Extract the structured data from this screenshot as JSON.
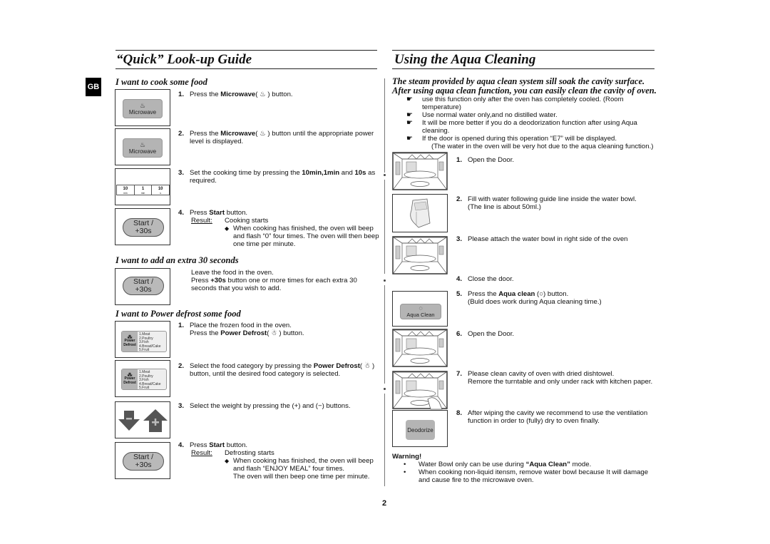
{
  "left": {
    "title": "“Quick” Look-up Guide",
    "lang_badge": "GB",
    "sections": {
      "cook": {
        "heading": "I want to cook some food",
        "steps": [
          {
            "num": "1.",
            "pre": "Press the ",
            "bold": "Microwave",
            "post": "( ♨ ) button."
          },
          {
            "num": "2.",
            "pre": "Press the ",
            "bold": "Microwave",
            "post": "( ♨ ) button until the appropriate power level is displayed."
          },
          {
            "num": "3.",
            "pre": "Set the cooking time by pressing the ",
            "bold": "10min,1min",
            "mid": " and ",
            "bold2": "10s",
            "post": " as required."
          },
          {
            "num": "4.",
            "pre": "Press ",
            "bold": "Start",
            "post": " button.",
            "result_label": "Result:",
            "result_value": "Cooking starts",
            "bullet": "When cooking has finished, the oven will beep and flash “0” four times. The oven will then beep one time per minute."
          }
        ]
      },
      "extra30": {
        "heading": "I want to add an extra 30 seconds",
        "line1": "Leave the food in the oven.",
        "pre": "Press ",
        "bold": "+30s",
        "post": " button one or more times for each extra 30 seconds that you wish to add."
      },
      "defrost": {
        "heading": "I want to Power defrost some food",
        "steps": [
          {
            "num": "1.",
            "line1": "Place the frozen food in the oven.",
            "pre": "Press the ",
            "bold": "Power Defrost",
            "post": "( ☃ ) button."
          },
          {
            "num": "2.",
            "pre": "Select the food category by pressing the ",
            "bold": "Power Defrost",
            "post": "( ☃ ) button, until the desired food category is selected."
          },
          {
            "num": "3.",
            "text": "Select the weight by pressing the (+) and (−) buttons."
          },
          {
            "num": "4.",
            "pre": "Press ",
            "bold": "Start",
            "post": " button.",
            "result_label": "Result:",
            "result_value": "Defrosting starts",
            "bullet": "When cooking has finished, the oven will beep and flash “ENJOY MEAL” four times.",
            "bullet2": "The oven will then beep one time per minute."
          }
        ]
      }
    },
    "buttons": {
      "microwave": "Microwave",
      "time_10min": "10",
      "time_10min_unit": "min",
      "time_1min": "1",
      "time_1min_unit": "min",
      "time_10s": "10",
      "time_10s_unit": "s",
      "start_line1": "Start  /",
      "start_line2": "+30s",
      "power": "Power",
      "defrost": "Defrost",
      "minus": "−",
      "plus": "+"
    },
    "defrost_categories": [
      "1.Meat",
      "2.Poultry",
      "3.Fish",
      "4.Bread/Cake",
      "5.Fruit"
    ]
  },
  "right": {
    "title": "Using the Aqua Cleaning",
    "intro": "The steam provided by aqua clean system sill soak the cavity surface. After using aqua clean function, you can easily clean the cavity of oven.",
    "notes": [
      "use this function only after the oven has completely cooled. (Room temperature)",
      "Use normal water only,and no distilled water.",
      "It will be more better if you do a deodorization function after using Aqua cleaning.",
      "If the door is opened during this operation “E7” will be displayed."
    ],
    "note_extra": "(The water in the oven will be very hot due to the aqua cleaning function.)",
    "steps": [
      {
        "num": "1.",
        "text": "Open the Door."
      },
      {
        "num": "2.",
        "text": "Fill with water following guide line inside the water bowl.",
        "text2": "(The line is about 50ml.)"
      },
      {
        "num": "3.",
        "text": "Please attach the water bowl in right side of the oven"
      },
      {
        "num": "4.",
        "text": "Close the door."
      },
      {
        "num": "5.",
        "pre": "Press the ",
        "bold": "Aqua clean",
        "post": " (○) button.",
        "text2": "(Buld does work during Aqua cleaning time.)"
      },
      {
        "num": "6.",
        "text": "Open the Door."
      },
      {
        "num": "7.",
        "text": "Please clean cavity of oven with dried dishtowel.",
        "text2": "Remore the turntable and only under rack with kitchen paper."
      },
      {
        "num": "8.",
        "text": "After wiping the cavity we recommend to use the ventilation function in order to (fully) dry to oven finally."
      }
    ],
    "buttons": {
      "aqua_clean": "Aqua Clean",
      "deodorize": "Deodorize"
    },
    "warning": {
      "title": "Warning!",
      "items": [
        {
          "pre": "Water Bowl only can be use during ",
          "bold": "“Aqua Clean”",
          "post": " mode."
        },
        {
          "text": "When cooking non-liquid itensm, remove water bowl because It will damage and cause fire to the microwave oven."
        }
      ]
    }
  },
  "page_number": "2"
}
